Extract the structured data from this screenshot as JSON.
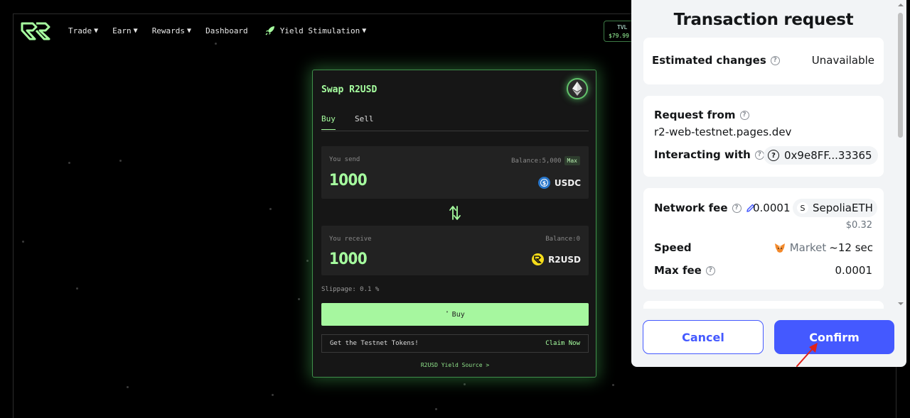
{
  "nav": {
    "items": [
      {
        "label": "Trade",
        "caret": "▼"
      },
      {
        "label": "Earn",
        "caret": "▼"
      },
      {
        "label": "Rewards",
        "caret": "▼"
      },
      {
        "label": "Dashboard",
        "caret": ""
      },
      {
        "label": "Yield Stimulation",
        "caret": "▼",
        "icon": "rocket-icon"
      }
    ],
    "tvl_label": "TVL",
    "tvl_value": "$79.99"
  },
  "swap": {
    "title": "Swap R2USD",
    "network_icon": "ethereum-icon",
    "tabs": [
      "Buy",
      "Sell"
    ],
    "active_tab": "Buy",
    "send": {
      "label": "You send",
      "balance": "Balance:5,000",
      "max_label": "Max",
      "amount": "1000",
      "token": "USDC",
      "token_icon": "usdc-icon"
    },
    "receive": {
      "label": "You receive",
      "balance": "Balance:0",
      "amount": "1000",
      "token": "R2USD",
      "token_icon": "r2usd-icon"
    },
    "slippage": "Slippage: 0.1 %",
    "buy_label": "Buy",
    "testnet_text": "Get the Testnet Tokens!",
    "claim_label": "Claim Now",
    "yield_source": "R2USD Yield Source >",
    "accent": "#a6ff9f"
  },
  "modal": {
    "title": "Transaction request",
    "estimated_changes_label": "Estimated changes",
    "estimated_changes_value": "Unavailable",
    "request_from_label": "Request from",
    "request_from_value": "r2-web-testnet.pages.dev",
    "interacting_with_label": "Interacting with",
    "interacting_with_value": "0x9e8FF...33365",
    "network_fee_label": "Network fee",
    "network_fee_value": "0.0001",
    "network_fee_token": "SepoliaETH",
    "network_fee_token_badge": "S",
    "network_fee_fiat": "$0.32",
    "speed_label": "Speed",
    "speed_value": "Market",
    "speed_time": "~12 sec",
    "max_fee_label": "Max fee",
    "max_fee_value": "0.0001",
    "cancel_label": "Cancel",
    "confirm_label": "Confirm",
    "primary_color": "#4459ff"
  }
}
